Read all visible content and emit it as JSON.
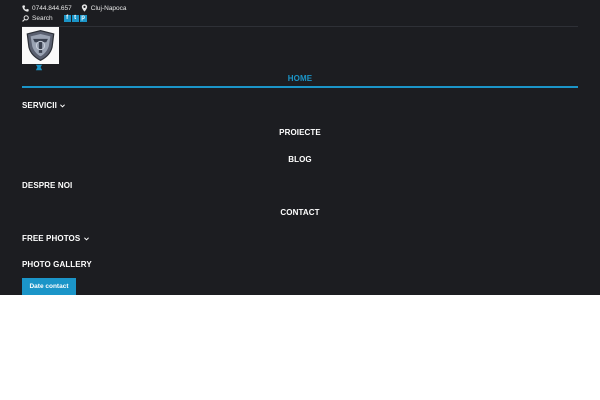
{
  "topbar": {
    "phone": "0744.844.657",
    "location": "Cluj-Napoca",
    "search_label": "Search",
    "social": [
      {
        "icon": "facebook-icon",
        "glyph": "f"
      },
      {
        "icon": "twitter-icon",
        "glyph": "t"
      },
      {
        "icon": "pinterest-icon",
        "glyph": "p"
      }
    ]
  },
  "nav": {
    "home": "HOME",
    "servicii": "SERVICII",
    "proiecte": "PROIECTE",
    "blog": "BLOG",
    "despre": "DESPRE NOI",
    "contact": "CONTACT",
    "free_photos": "FREE PHOTOS",
    "gallery": "PHOTO GALLERY"
  },
  "cta": {
    "label": "Date contact"
  },
  "colors": {
    "accent": "#1b95c8",
    "background": "#1c1d21"
  }
}
